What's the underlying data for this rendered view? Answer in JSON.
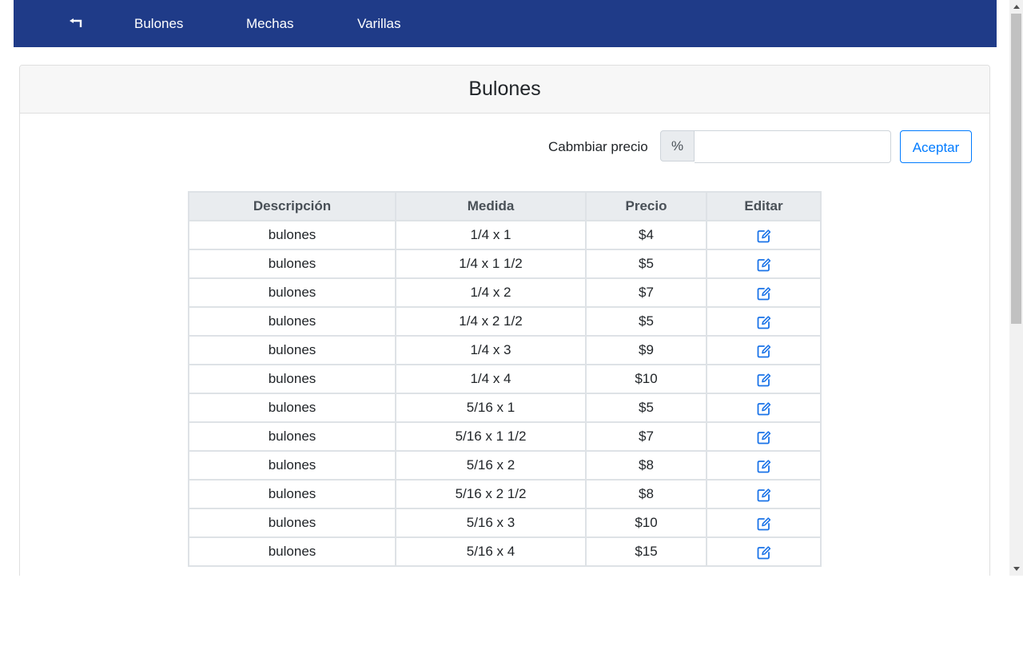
{
  "nav": {
    "back_icon": "back-arrow-icon",
    "links": [
      "Bulones",
      "Mechas",
      "Varillas"
    ]
  },
  "card": {
    "title": "Bulones"
  },
  "price_change": {
    "label": "Cabmbiar precio",
    "addon": "%",
    "value": "",
    "button_label": "Aceptar"
  },
  "table": {
    "headers": [
      "Descripción",
      "Medida",
      "Precio",
      "Editar"
    ],
    "rows": [
      {
        "descripcion": "bulones",
        "medida": "1/4 x 1",
        "precio": "$4"
      },
      {
        "descripcion": "bulones",
        "medida": "1/4 x 1 1/2",
        "precio": "$5"
      },
      {
        "descripcion": "bulones",
        "medida": "1/4 x 2",
        "precio": "$7"
      },
      {
        "descripcion": "bulones",
        "medida": "1/4 x 2 1/2",
        "precio": "$5"
      },
      {
        "descripcion": "bulones",
        "medida": "1/4 x 3",
        "precio": "$9"
      },
      {
        "descripcion": "bulones",
        "medida": "1/4 x 4",
        "precio": "$10"
      },
      {
        "descripcion": "bulones",
        "medida": "5/16 x 1",
        "precio": "$5"
      },
      {
        "descripcion": "bulones",
        "medida": "5/16 x 1 1/2",
        "precio": "$7"
      },
      {
        "descripcion": "bulones",
        "medida": "5/16 x 2",
        "precio": "$8"
      },
      {
        "descripcion": "bulones",
        "medida": "5/16 x 2 1/2",
        "precio": "$8"
      },
      {
        "descripcion": "bulones",
        "medida": "5/16 x 3",
        "precio": "$10"
      },
      {
        "descripcion": "bulones",
        "medida": "5/16 x 4",
        "precio": "$15"
      }
    ],
    "edit_icon": "edit-icon"
  },
  "colors": {
    "navbar": "#1f3b88",
    "accent": "#007bff",
    "header_bg": "#e9ecef"
  }
}
